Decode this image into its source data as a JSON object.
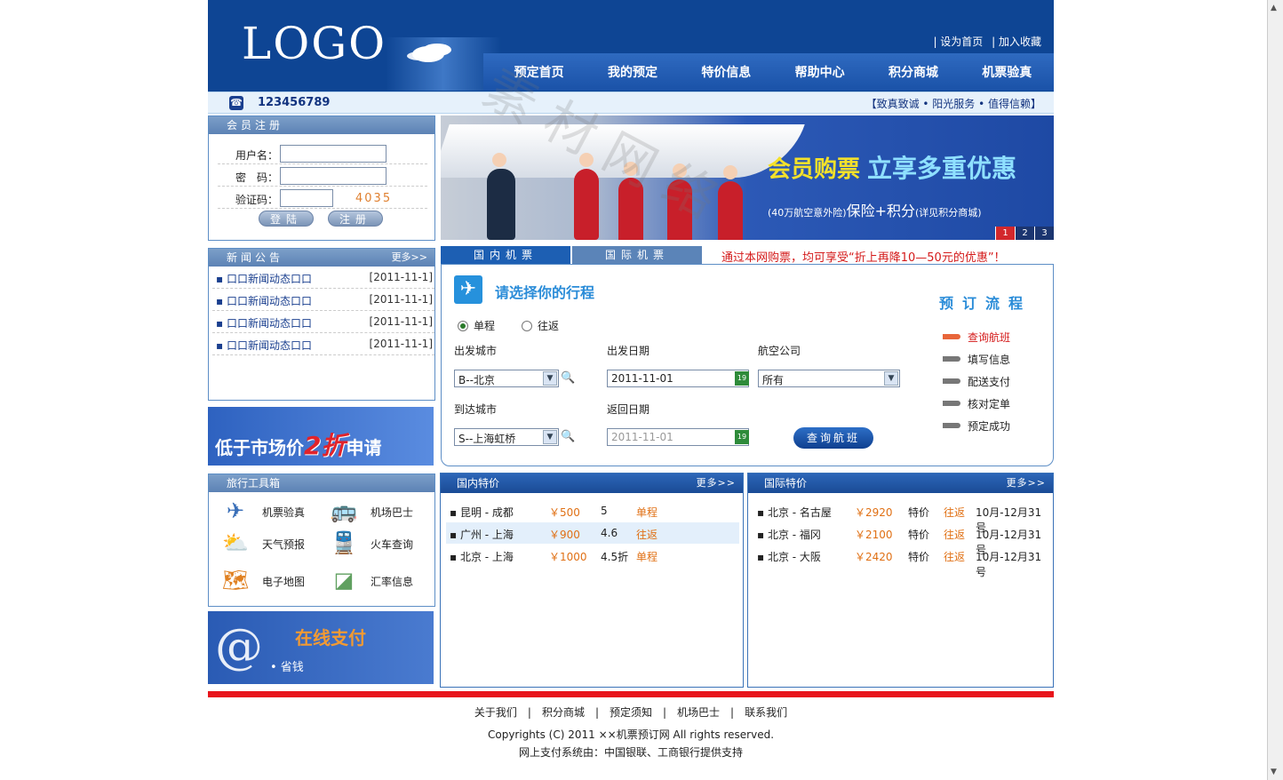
{
  "header": {
    "logo": "LOGO",
    "top_links": [
      "| 设为首页",
      "| 加入收藏"
    ],
    "nav": [
      "预定首页",
      "我的预定",
      "特价信息",
      "帮助中心",
      "积分商城",
      "机票验真"
    ]
  },
  "phonebar": {
    "phone": "123456789",
    "slogan": "【致真致诚 • 阳光服务 • 值得信赖】"
  },
  "register": {
    "title": "会员注册",
    "username_label": "用户名：",
    "password_label": "密　码：",
    "captcha_label": "验证码：",
    "captcha_value": "4035",
    "login_button": "登陆",
    "register_button": "注册"
  },
  "news": {
    "title": "新闻公告",
    "more": "更多>>",
    "items": [
      {
        "title": "▪ 口口新闻动态口口",
        "date": "[2011-11-1]"
      },
      {
        "title": "▪ 口口新闻动态口口",
        "date": "[2011-11-1]"
      },
      {
        "title": "▪ 口口新闻动态口口",
        "date": "[2011-11-1]"
      },
      {
        "title": "▪ 口口新闻动态口口",
        "date": "[2011-11-1]"
      }
    ]
  },
  "promo": {
    "prefix": "低于市场价",
    "big": "2折",
    "suffix": "申请"
  },
  "tools": {
    "title": "旅行工具箱",
    "items": [
      {
        "label": "机票验真",
        "icon": "airplane-icon"
      },
      {
        "label": "机场巴士",
        "icon": "bus-icon"
      },
      {
        "label": "天气预报",
        "icon": "weather-icon"
      },
      {
        "label": "火车查询",
        "icon": "train-icon"
      },
      {
        "label": "电子地图",
        "icon": "map-icon"
      },
      {
        "label": "汇率信息",
        "icon": "exchange-icon"
      }
    ]
  },
  "pay": {
    "title": "在线支付",
    "sub": "• 省钱"
  },
  "banner": {
    "line1": "会员购票",
    "line2": "立享多重优惠",
    "line3_small1": "(40万航空意外险)",
    "line3": "保险+积分",
    "line3_small2": "(详见积分商城)",
    "pages": [
      "1",
      "2",
      "3"
    ],
    "watermark": "素材网络"
  },
  "booking": {
    "tabs": [
      "国内机票",
      "国际机票"
    ],
    "promo": "通过本网购票，均可享受“折上再降10—50元的优惠”！",
    "title": "请选择你的行程",
    "trip_one_way": "单程",
    "trip_round": "往返",
    "from_label": "出发城市",
    "from_value": "B--北京",
    "depart_label": "出发日期",
    "depart_value": "2011-11-01",
    "airline_label": "航空公司",
    "airline_value": "所有",
    "to_label": "到达城市",
    "to_value": "S--上海虹桥",
    "return_label": "返回日期",
    "return_value": "2011-11-01",
    "search_button": "查询航班",
    "flow_title": "预订流程",
    "steps": [
      "查询航班",
      "填写信息",
      "配送支付",
      "核对定单",
      "预定成功"
    ]
  },
  "domestic": {
    "title": "国内特价",
    "more": "更多>>",
    "rows": [
      {
        "route": "▪ 昆明 - 成都",
        "price": "￥500",
        "disc": "5",
        "kind": "单程"
      },
      {
        "route": "▪ 广州 - 上海",
        "price": "￥900",
        "disc": "4.6",
        "kind": "往返"
      },
      {
        "route": "▪ 北京 - 上海",
        "price": "￥1000",
        "disc": "4.5折",
        "kind": "单程"
      }
    ]
  },
  "international": {
    "title": "国际特价",
    "more": "更多>>",
    "rows": [
      {
        "route": "▪ 北京 - 名古屋",
        "price": "￥2920",
        "type": "特价",
        "kind": "往返",
        "period": "10月-12月31号"
      },
      {
        "route": "▪ 北京 - 福冈",
        "price": "￥2100",
        "type": "特价",
        "kind": "往返",
        "period": "10月-12月31号"
      },
      {
        "route": "▪ 北京 - 大阪",
        "price": "￥2420",
        "type": "特价",
        "kind": "往返",
        "period": "10月-12月31号"
      }
    ]
  },
  "footer": {
    "links": "关于我们　|　积分商城　|　预定须知　|　机场巴士　|　联系我们",
    "copyright": "Copyrights (C) 2011  ××机票预订网  All rights reserved.",
    "pay_system": "网上支付系统由：中国银联、工商银行提供支持"
  }
}
